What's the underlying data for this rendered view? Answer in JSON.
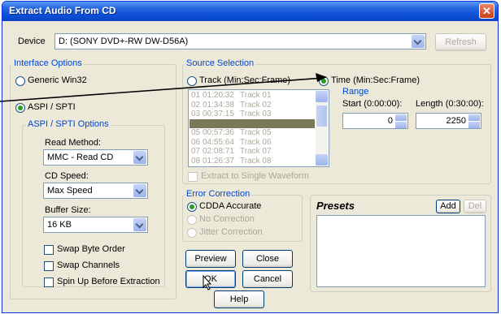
{
  "window": {
    "title": "Extract Audio From CD",
    "close_glyph": "✕"
  },
  "device": {
    "label": "Device",
    "value": "D: (SONY DVD+-RW DW-D56A)",
    "refresh": "Refresh"
  },
  "interface": {
    "group_label": "Interface Options",
    "generic": "Generic Win32",
    "aspi": "ASPI / SPTI",
    "aspi_group_label": "ASPI / SPTI Options",
    "read_method_label": "Read Method:",
    "read_method_value": "MMC - Read CD",
    "cd_speed_label": "CD Speed:",
    "cd_speed_value": "Max Speed",
    "buffer_label": "Buffer Size:",
    "buffer_value": "16 KB",
    "swap_byte": "Swap Byte Order",
    "swap_channels": "Swap Channels",
    "spin_up": "Spin Up Before Extraction"
  },
  "source": {
    "group_label": "Source Selection",
    "track_label": "Track (Min:Sec:Frame)",
    "time_label": "Time (Min:Sec:Frame)",
    "range_label": "Range",
    "start_label": "Start (0:00:00):",
    "length_label": "Length (0:30:00):",
    "start_value": "0",
    "length_value": "2250",
    "extract_single": "Extract to Single Waveform",
    "tracks": [
      {
        "num": "01",
        "time": "01:20:32",
        "name": "Track 01"
      },
      {
        "num": "02",
        "time": "01:34:38",
        "name": "Track 02"
      },
      {
        "num": "03",
        "time": "00:37:15",
        "name": "Track 03"
      },
      {
        "num": "04",
        "time": "",
        "name": ""
      },
      {
        "num": "05",
        "time": "00:57:36",
        "name": "Track 05"
      },
      {
        "num": "06",
        "time": "04:55:64",
        "name": "Track 06"
      },
      {
        "num": "07",
        "time": "02:08:71",
        "name": "Track 07"
      },
      {
        "num": "08",
        "time": "01:26:37",
        "name": "Track 08"
      }
    ]
  },
  "error": {
    "group_label": "Error Correction",
    "cdda": "CDDA Accurate",
    "none": "No Correction",
    "jitter": "Jitter Correction"
  },
  "presets": {
    "title": "Presets",
    "add": "Add",
    "del": "Del"
  },
  "buttons": {
    "preview": "Preview",
    "close": "Close",
    "ok": "OK",
    "cancel": "Cancel",
    "help": "Help"
  },
  "colors": {
    "title_blue": "#0b4fd7",
    "group_label": "#0046d5",
    "radio_on": "#21a121"
  }
}
